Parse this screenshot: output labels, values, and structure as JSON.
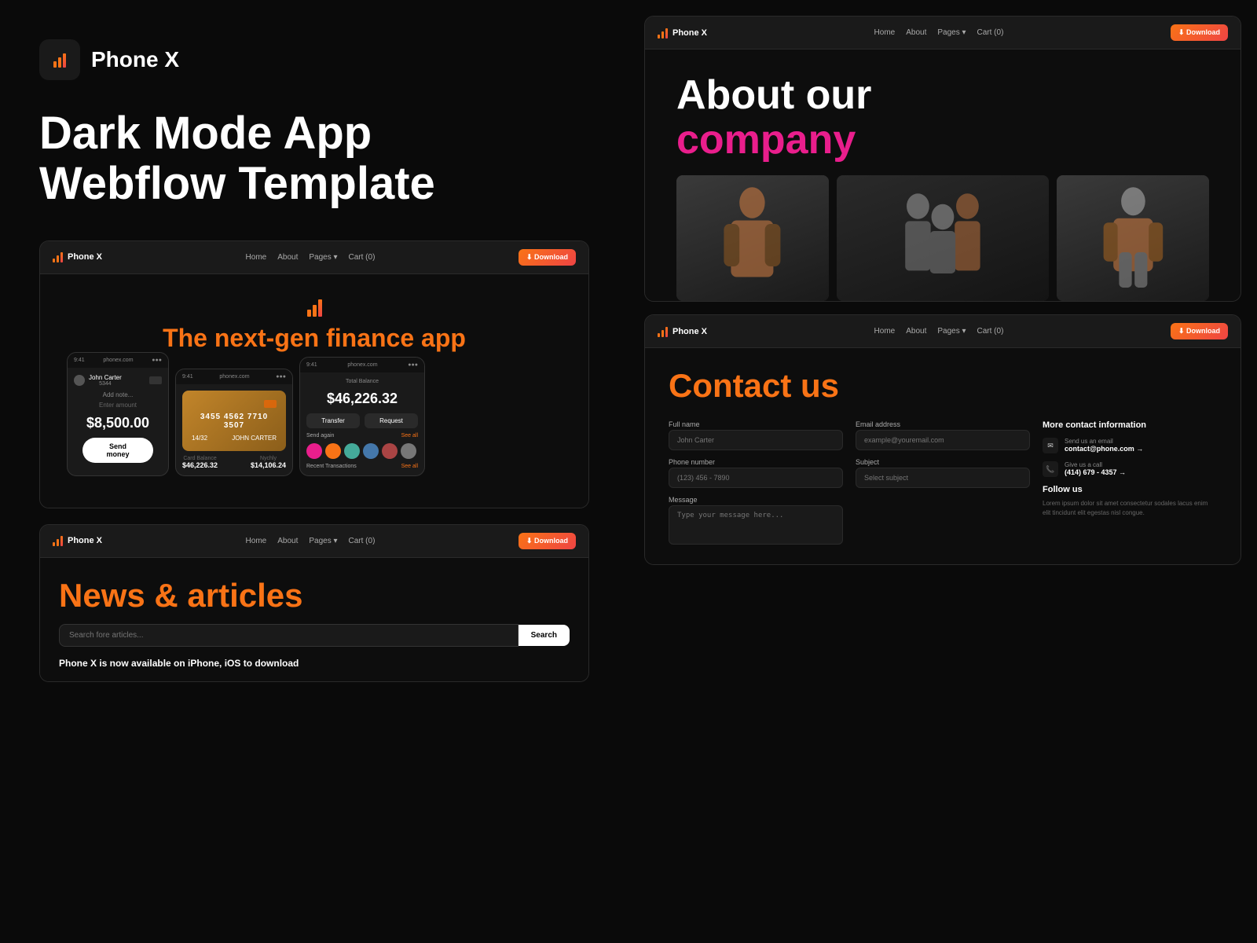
{
  "brand": {
    "name": "Phone X",
    "tagline": "Dark Mode App\nWebflow Template"
  },
  "left": {
    "hero": {
      "line1": "Dark Mode App",
      "line2": "Webflow Template"
    },
    "browser1": {
      "brand": "Phone X",
      "nav": [
        "Home",
        "About",
        "Pages",
        "Cart (0)"
      ],
      "download_btn": "⬇ Download",
      "hero_title_white": "The ",
      "hero_title_orange": "next-gen",
      "hero_title_end": " finance app",
      "phone1": {
        "time": "9:41",
        "url": "phonex.com",
        "user": "John Carter",
        "id": "5344",
        "label": "Add note...",
        "amount_label": "Enter amount",
        "amount": "$8,500.00",
        "btn": "Send money"
      },
      "phone2": {
        "time": "9:41",
        "url": "phonex.com",
        "card_number": "3455 4562 7710 3507",
        "expiry": "14/32",
        "name": "JOHN CARTER",
        "card_balance": "$46,226.32",
        "status": "$14,106.24"
      },
      "phone3": {
        "time": "9:41",
        "url": "phonex.com",
        "total": "Total Balance",
        "amount": "$46,226.32",
        "btn1": "Transfer",
        "btn2": "Request",
        "label": "Send again",
        "see_all": "See all",
        "transactions": "Recent Transactions",
        "see_all2": "See all"
      }
    },
    "browser2": {
      "brand": "Phone X",
      "nav": [
        "Home",
        "About",
        "Pages",
        "Cart (0)"
      ],
      "download_btn": "⬇ Download",
      "title_white": "News & ",
      "title_orange": "articles",
      "search_placeholder": "Search fore articles...",
      "search_btn": "Search",
      "subtitle": "Phone X is now available on iPhone, iOS to download"
    }
  },
  "right": {
    "about_browser": {
      "brand": "Phone X",
      "nav": [
        "Home",
        "About",
        "Pages",
        "Cart (0)"
      ],
      "download_btn": "⬇ Download",
      "title_white": "About our",
      "title_pink": "company"
    },
    "contact_browser": {
      "brand": "Phone X",
      "nav": [
        "Home",
        "About",
        "Pages",
        "Cart (0)"
      ],
      "download_btn": "⬇ Download",
      "title_white": "Contact ",
      "title_orange": "us",
      "form": {
        "fullname_label": "Full name",
        "fullname_placeholder": "John Carter",
        "email_label": "Email address",
        "email_placeholder": "example@youremail.com",
        "phone_label": "Phone number",
        "phone_placeholder": "(123) 456 - 7890",
        "subject_label": "Subject",
        "subject_placeholder": "Select subject",
        "message_label": "Message",
        "message_placeholder": "Type your message here..."
      },
      "contact_info": {
        "title": "More contact information",
        "email_label": "Send us an email",
        "email": "contact@phone.com →",
        "phone_label": "Give us a call",
        "phone": "(414) 679 - 4357 →",
        "follow_title": "Follow us",
        "follow_text": "Lorem ipsum dolor sit amet consectetur sodales lacus enim elit tincidunt elit egestas nisl congue."
      }
    }
  }
}
